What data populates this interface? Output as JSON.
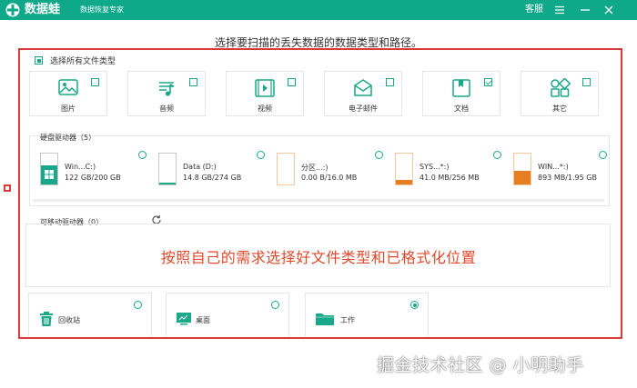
{
  "app": {
    "name": "数据蛙",
    "subtitle": "数据恢复专家",
    "service": "客服"
  },
  "colors": {
    "brand": "#0fa98a",
    "accent": "#1aa88a",
    "highlight_border": "#d93b3b",
    "overlay_text": "#e0492b",
    "disk_orange": "#e67e22"
  },
  "heading": "选择要扫描的丢失数据的数据类型和路径。",
  "select_all": {
    "label": "选择所有文件类型",
    "state": "partial"
  },
  "file_types": [
    {
      "label": "图片",
      "icon": "image-icon",
      "checked": false
    },
    {
      "label": "音频",
      "icon": "music-icon",
      "checked": false
    },
    {
      "label": "视频",
      "icon": "video-icon",
      "checked": false
    },
    {
      "label": "电子邮件",
      "icon": "email-icon",
      "checked": false
    },
    {
      "label": "文档",
      "icon": "document-icon",
      "checked": true
    },
    {
      "label": "其它",
      "icon": "other-icon",
      "checked": false
    }
  ],
  "disks": {
    "title": "硬盘驱动器（5）",
    "items": [
      {
        "name": "Win...C:)",
        "size": "122 GB/200 GB",
        "used_fraction": 0.61,
        "fill": "#1aa88a",
        "system": true
      },
      {
        "name": "Data (D:)",
        "size": "14.8 GB/274 GB",
        "used_fraction": 0.054,
        "fill": "#1aa88a",
        "system": false
      },
      {
        "name": "分区...:)",
        "size": "0.00  B/16.0 MB",
        "used_fraction": 0.0,
        "fill": "#e67e22",
        "system": false
      },
      {
        "name": "SYS...*:)",
        "size": "41.0 MB/256 MB",
        "used_fraction": 0.16,
        "fill": "#e67e22",
        "system": false
      },
      {
        "name": "WIN...*:)",
        "size": "893 MB/1.95 GB",
        "used_fraction": 0.45,
        "fill": "#e67e22",
        "system": false
      }
    ]
  },
  "removable": {
    "title": "可移动驱动器（0）"
  },
  "overlay_note": "按照自己的需求选择好文件类型和已格式化位置",
  "locations": [
    {
      "label": "回收站",
      "icon": "recycle-bin-icon",
      "selected": false
    },
    {
      "label": "桌面",
      "icon": "desktop-icon",
      "selected": false
    },
    {
      "label": "工作",
      "icon": "folder-icon",
      "selected": true
    }
  ],
  "watermark": "掘金技术社区 @ 小明助手"
}
